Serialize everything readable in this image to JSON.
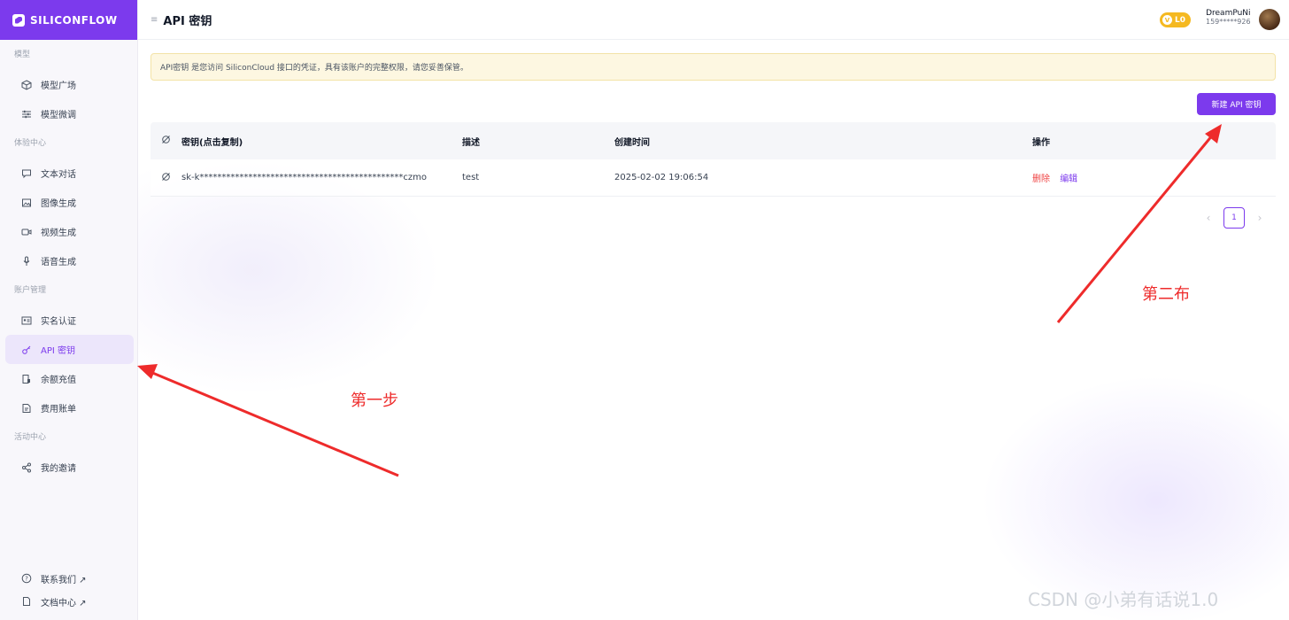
{
  "brand": {
    "logo_text": "SILICONFLOW"
  },
  "sidebar": {
    "sections": [
      {
        "label": "模型",
        "items": [
          {
            "label": "模型广场",
            "icon": "cube-icon"
          },
          {
            "label": "模型微调",
            "icon": "sliders-icon"
          }
        ]
      },
      {
        "label": "体验中心",
        "items": [
          {
            "label": "文本对话",
            "icon": "chat-icon"
          },
          {
            "label": "图像生成",
            "icon": "image-icon"
          },
          {
            "label": "视频生成",
            "icon": "video-icon"
          },
          {
            "label": "语音生成",
            "icon": "microphone-icon"
          }
        ]
      },
      {
        "label": "账户管理",
        "items": [
          {
            "label": "实名认证",
            "icon": "id-card-icon"
          },
          {
            "label": "API 密钥",
            "icon": "key-icon",
            "active": true
          },
          {
            "label": "余额充值",
            "icon": "wallet-icon"
          },
          {
            "label": "费用账单",
            "icon": "bill-icon"
          }
        ]
      },
      {
        "label": "活动中心",
        "items": [
          {
            "label": "我的邀请",
            "icon": "share-icon"
          }
        ]
      }
    ],
    "bottom": [
      {
        "label": "联系我们 ↗",
        "icon": "help-circle-icon"
      },
      {
        "label": "文档中心 ↗",
        "icon": "document-icon"
      }
    ]
  },
  "header": {
    "title": "API 密钥",
    "level_badge": "L0",
    "level_glyph": "V",
    "user_name": "DreamPuNi",
    "user_phone": "159*****926"
  },
  "notice": "API密钥 是您访问 SiliconCloud 接口的凭证，具有该账户的完整权限，请您妥善保管。",
  "new_key_button": "新建 API 密钥",
  "table": {
    "columns": [
      "密钥(点击复制)",
      "描述",
      "创建时间",
      "操作"
    ],
    "rows": [
      {
        "key": "sk-k**********************************************czmo",
        "description": "test",
        "created": "2025-02-02 19:06:54",
        "actions": {
          "delete": "删除",
          "edit": "编辑"
        }
      }
    ]
  },
  "pagination": {
    "current_page": "1",
    "prev": "‹",
    "next": "›"
  },
  "annotations": {
    "step1": "第一步",
    "step2": "第二布"
  },
  "watermark": "CSDN @小弟有话说1.0",
  "colors": {
    "accent": "#7c3aed",
    "danger": "#ef4444",
    "annotation": "#ee2b2b",
    "badge": "#f5b921"
  }
}
